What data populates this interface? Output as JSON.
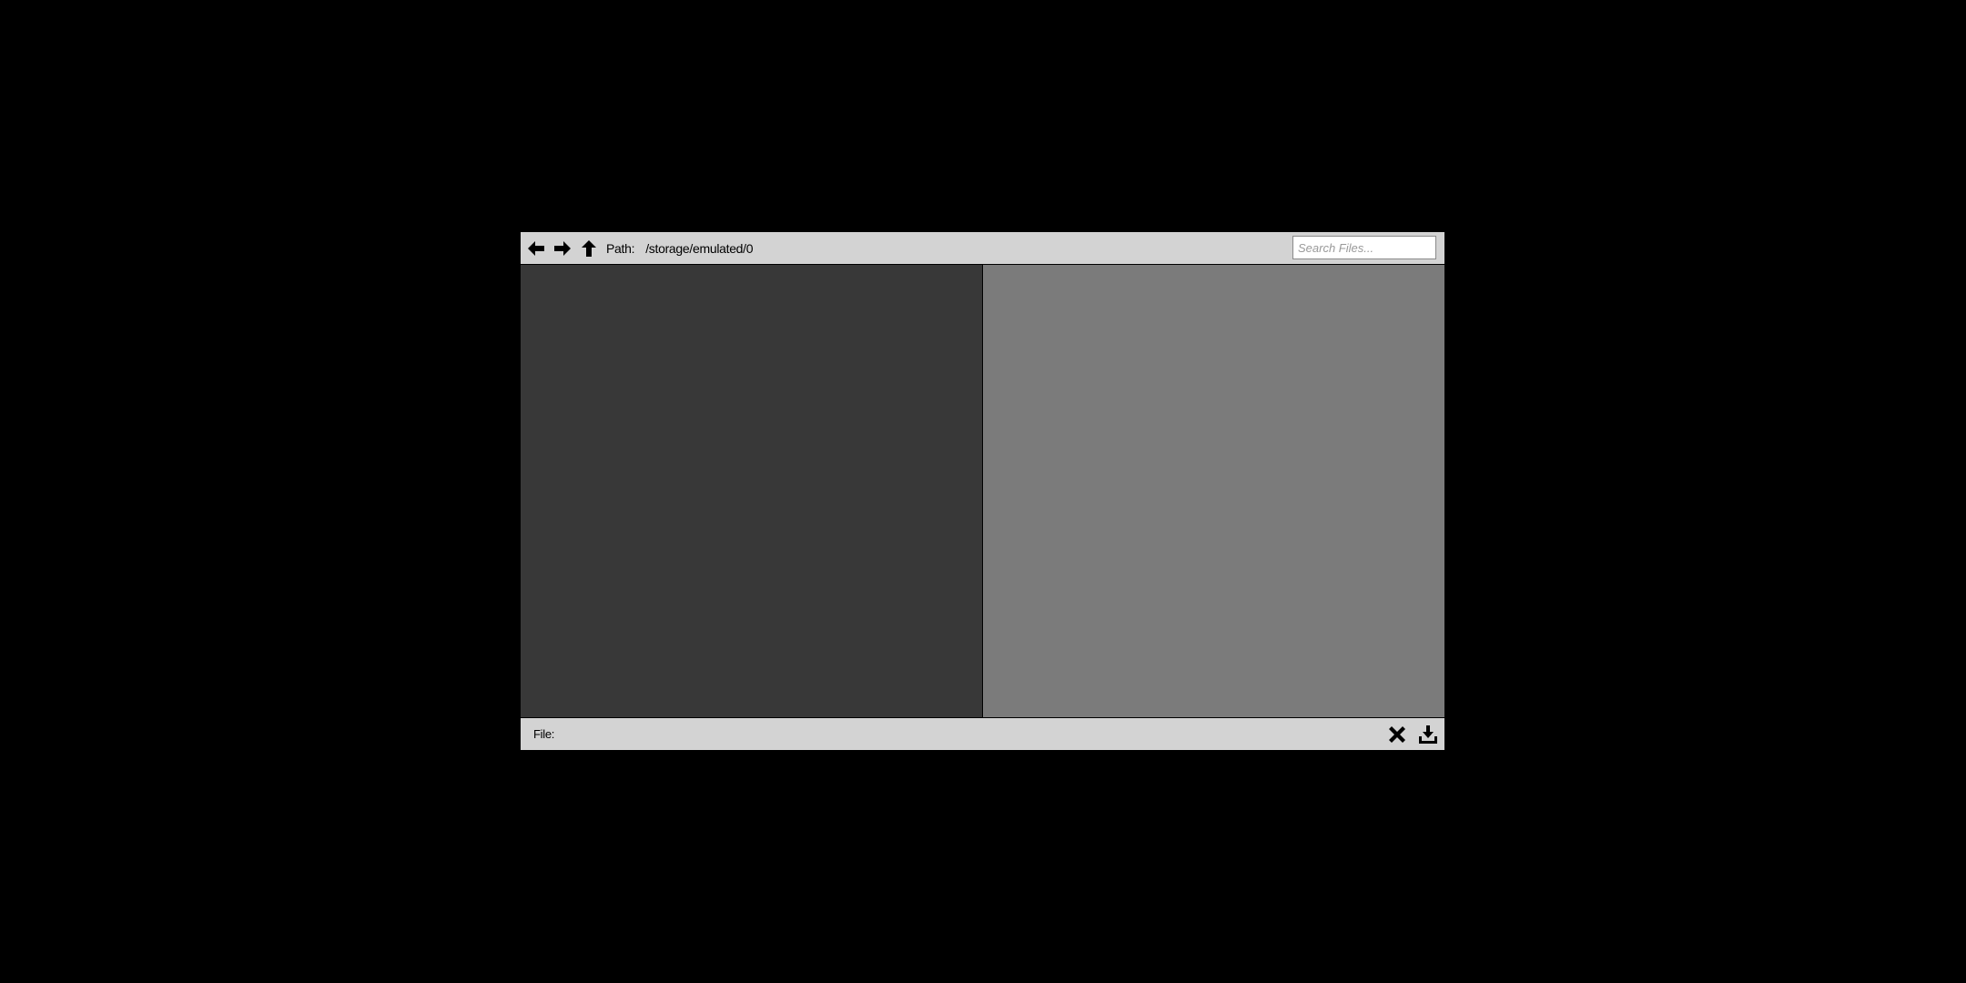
{
  "toolbar": {
    "back_icon": "arrow-left-icon",
    "forward_icon": "arrow-right-icon",
    "up_icon": "arrow-up-icon",
    "path_label": "Path:",
    "path_value": "/storage/emulated/0",
    "search_placeholder": "Search Files...",
    "search_value": ""
  },
  "panes": {
    "left_background": "#383838",
    "right_background": "#7b7b7b",
    "left_items": [],
    "right_items": []
  },
  "statusbar": {
    "file_label": "File:",
    "file_value": "",
    "cancel_icon": "close-icon",
    "save_icon": "download-tray-icon"
  },
  "colors": {
    "background": "#000000",
    "chrome": "#d3d3d3"
  }
}
